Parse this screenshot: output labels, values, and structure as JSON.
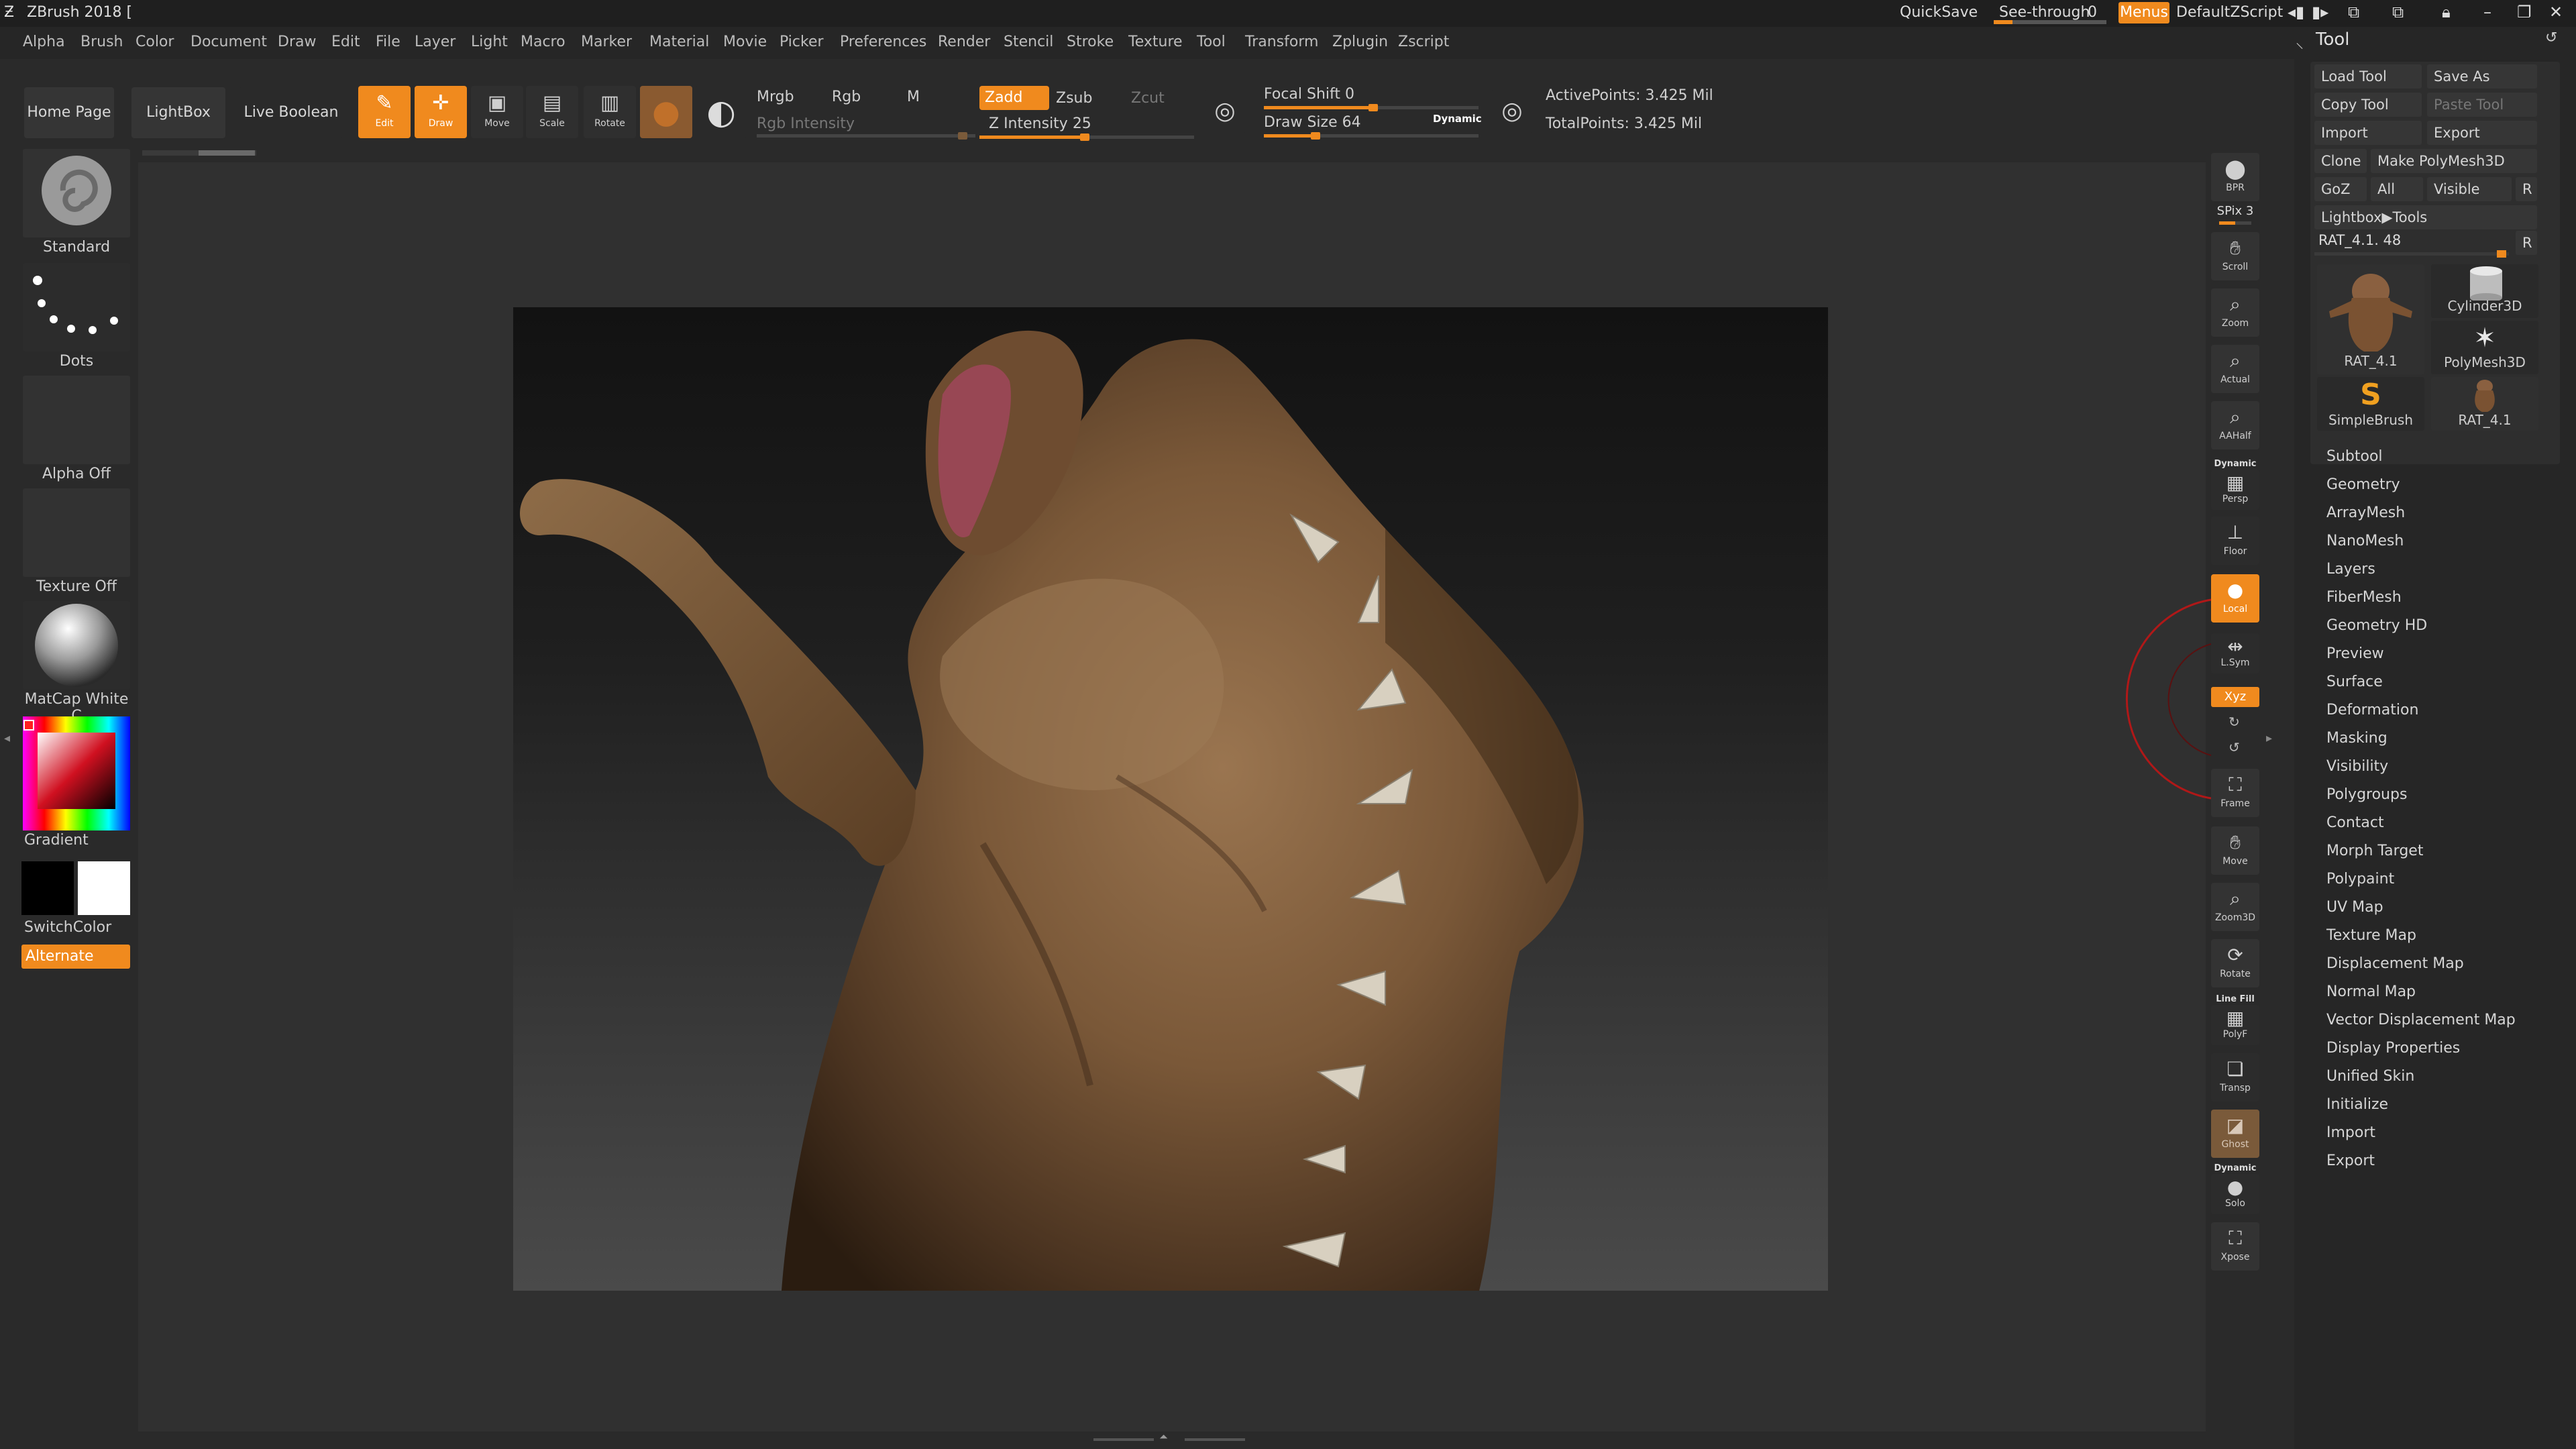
{
  "window": {
    "title": "ZBrush 2018 [",
    "quicksave": "QuickSave",
    "see_through_label": "See-through",
    "see_through_value": "0",
    "menus_label": "Menus",
    "script_label": "DefaultZScript"
  },
  "menu": [
    "Alpha",
    "Brush",
    "Color",
    "Document",
    "Draw",
    "Edit",
    "File",
    "Layer",
    "Light",
    "Macro",
    "Marker",
    "Material",
    "Movie",
    "Picker",
    "Preferences",
    "Render",
    "Stencil",
    "Stroke",
    "Texture",
    "Tool",
    "Transform",
    "Zplugin",
    "Zscript"
  ],
  "toolbar": {
    "home_page": "Home Page",
    "lightbox": "LightBox",
    "live_boolean": "Live Boolean",
    "edit": "Edit",
    "draw": "Draw",
    "move": "Move",
    "scale": "Scale",
    "rotate": "Rotate",
    "mrgb": "Mrgb",
    "rgb": "Rgb",
    "m": "M",
    "rgb_intensity": "Rgb Intensity",
    "zadd": "Zadd",
    "zsub": "Zsub",
    "zcut": "Zcut",
    "z_intensity": "Z Intensity 25",
    "focal_shift": "Focal Shift 0",
    "draw_size": "Draw Size 64",
    "dynamic": "Dynamic",
    "active_points": "ActivePoints: 3.425 Mil",
    "total_points": "TotalPoints: 3.425 Mil",
    "z_intensity_value": 25,
    "draw_size_value": 64
  },
  "left_shelf": {
    "brush": "Standard",
    "stroke": "Dots",
    "alpha": "Alpha Off",
    "texture": "Texture Off",
    "material": "MatCap White C",
    "gradient": "Gradient",
    "switch_color": "SwitchColor",
    "alternate": "Alternate"
  },
  "right_shelf": [
    {
      "name": "BPR",
      "label": "BPR"
    },
    {
      "name": "SPix",
      "label": "SPix 3"
    },
    {
      "name": "Scroll",
      "label": "Scroll"
    },
    {
      "name": "Zoom",
      "label": "Zoom"
    },
    {
      "name": "Actual",
      "label": "Actual"
    },
    {
      "name": "AAHalf",
      "label": "AAHalf"
    },
    {
      "name": "Persp",
      "label": "Persp"
    },
    {
      "name": "Floor",
      "label": "Floor"
    },
    {
      "name": "Local",
      "label": "Local"
    },
    {
      "name": "LSym",
      "label": "L.Sym"
    },
    {
      "name": "Xyz",
      "label": "Xyz"
    },
    {
      "name": "Frame",
      "label": "Frame"
    },
    {
      "name": "Move",
      "label": "Move"
    },
    {
      "name": "Zoom3D",
      "label": "Zoom3D"
    },
    {
      "name": "Rotate",
      "label": "Rotate"
    },
    {
      "name": "PolyF",
      "label": "PolyF"
    },
    {
      "name": "Transp",
      "label": "Transp"
    },
    {
      "name": "Ghost",
      "label": "Ghost"
    },
    {
      "name": "Solo",
      "label": "Solo"
    },
    {
      "name": "Xpose",
      "label": "Xpose"
    }
  ],
  "right_shelf_extra": {
    "dynamic_persp": "Dynamic",
    "line_fill": "Line Fill",
    "dynamic_solo": "Dynamic"
  },
  "tool_panel": {
    "title": "Tool",
    "load_tool": "Load Tool",
    "save_as": "Save As",
    "copy_tool": "Copy Tool",
    "paste_tool": "Paste Tool",
    "import": "Import",
    "export": "Export",
    "clone": "Clone",
    "make_polymesh": "Make PolyMesh3D",
    "goz": "GoZ",
    "all": "All",
    "visible": "Visible",
    "r": "R",
    "lightbox_tools": "Lightbox▶Tools",
    "current_tool": "RAT_4.1. 48",
    "thumbs": [
      "RAT_4.1",
      "Cylinder3D",
      "PolyMesh3D",
      "SimpleBrush",
      "RAT_4.1"
    ],
    "sections": [
      "Subtool",
      "Geometry",
      "ArrayMesh",
      "NanoMesh",
      "Layers",
      "FiberMesh",
      "Geometry HD",
      "Preview",
      "Surface",
      "Deformation",
      "Masking",
      "Visibility",
      "Polygroups",
      "Contact",
      "Morph Target",
      "Polypaint",
      "UV Map",
      "Texture Map",
      "Displacement Map",
      "Normal Map",
      "Vector Displacement Map",
      "Display Properties",
      "Unified Skin",
      "Initialize",
      "Import",
      "Export"
    ]
  },
  "colors": {
    "accent": "#f08a1e",
    "background": "#2a2a2a",
    "panel": "#262626"
  }
}
